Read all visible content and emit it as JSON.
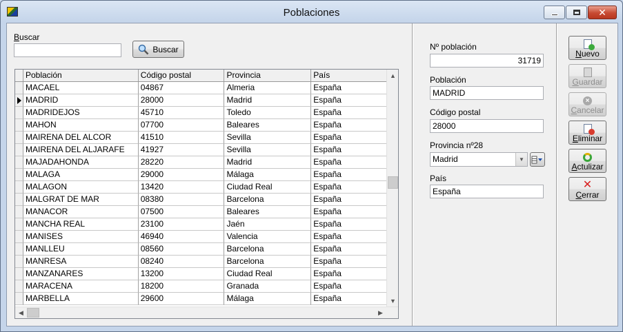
{
  "window": {
    "title": "Poblaciones"
  },
  "search": {
    "label_accel": "B",
    "label_rest": "uscar",
    "value": "",
    "button_label": "Buscar"
  },
  "grid": {
    "columns": [
      "Población",
      "Código postal",
      "Provincia",
      "País"
    ],
    "selected_row": 1,
    "rows": [
      [
        "MACAEL",
        "04867",
        "Almeria",
        "España"
      ],
      [
        "MADRID",
        "28000",
        "Madrid",
        "España"
      ],
      [
        "MADRIDEJOS",
        "45710",
        "Toledo",
        "España"
      ],
      [
        "MAHON",
        "07700",
        "Baleares",
        "España"
      ],
      [
        "MAIRENA DEL ALCOR",
        "41510",
        "Sevilla",
        "España"
      ],
      [
        "MAIRENA DEL ALJARAFE",
        "41927",
        "Sevilla",
        "España"
      ],
      [
        "MAJADAHONDA",
        "28220",
        "Madrid",
        "España"
      ],
      [
        "MALAGA",
        "29000",
        "Málaga",
        "España"
      ],
      [
        "MALAGON",
        "13420",
        "Ciudad Real",
        "España"
      ],
      [
        "MALGRAT DE MAR",
        "08380",
        "Barcelona",
        "España"
      ],
      [
        "MANACOR",
        "07500",
        "Baleares",
        "España"
      ],
      [
        "MANCHA REAL",
        "23100",
        "Jaén",
        "España"
      ],
      [
        "MANISES",
        "46940",
        "Valencia",
        "España"
      ],
      [
        "MANLLEU",
        "08560",
        "Barcelona",
        "España"
      ],
      [
        "MANRESA",
        "08240",
        "Barcelona",
        "España"
      ],
      [
        "MANZANARES",
        "13200",
        "Ciudad Real",
        "España"
      ],
      [
        "MARACENA",
        "18200",
        "Granada",
        "España"
      ],
      [
        "MARBELLA",
        "29600",
        "Málaga",
        "España"
      ]
    ]
  },
  "detail": {
    "num_label": "Nº población",
    "num_value": "31719",
    "poblacion_label": "Población",
    "poblacion_value": "MADRID",
    "cp_label": "Código postal",
    "cp_value": "28000",
    "provincia_label": "Provincia nº28",
    "provincia_value": "Madrid",
    "pais_label": "País",
    "pais_value": "España"
  },
  "actions": {
    "nuevo": {
      "accel": "N",
      "rest": "uevo"
    },
    "guardar": {
      "accel": "G",
      "rest": "uardar"
    },
    "cancelar": {
      "accel": "C",
      "rest": "ancelar"
    },
    "eliminar": {
      "accel": "E",
      "rest": "liminar"
    },
    "actualizar": {
      "accel": "A",
      "rest": "ctulizar"
    },
    "cerrar": {
      "accel": "C",
      "rest": "errar"
    }
  },
  "icons": {
    "app": "app-icon",
    "search": "magnifier-icon",
    "nuevo": "new-document-icon",
    "guardar": "save-document-icon",
    "cancelar": "cancel-icon",
    "eliminar": "delete-document-icon",
    "actualizar": "refresh-icon",
    "cerrar": "close-x-icon"
  }
}
